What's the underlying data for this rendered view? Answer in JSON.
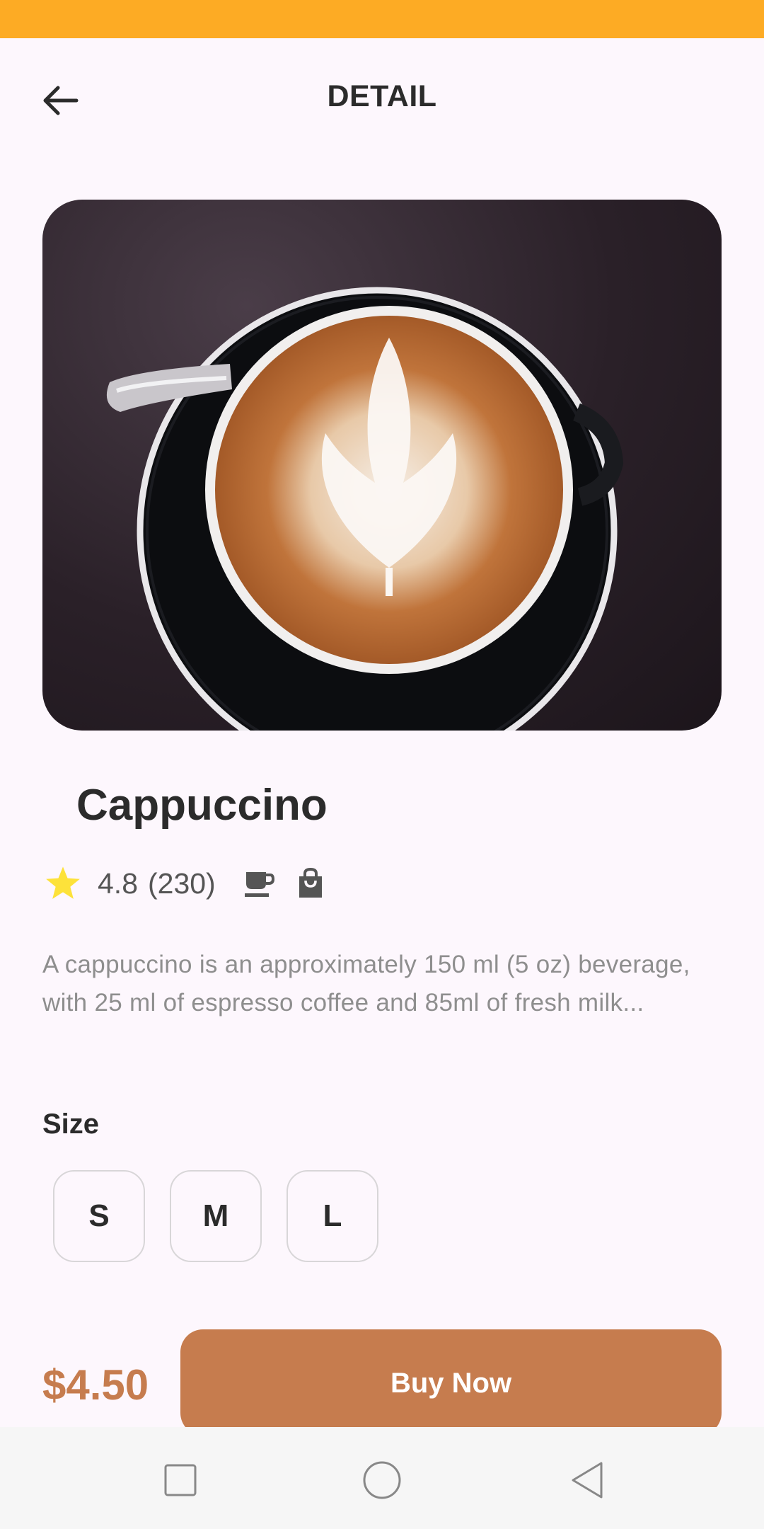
{
  "header": {
    "title": "DETAIL"
  },
  "product": {
    "name": "Cappuccino",
    "rating": "4.8",
    "review_count": "(230)",
    "description": "A cappuccino is an approximately 150 ml (5 oz) beverage, with 25 ml of espresso coffee and 85ml of fresh milk...",
    "price": "$4.50",
    "image": "cappuccino-latte-art-photo"
  },
  "size_section": {
    "label": "Size",
    "options": [
      "S",
      "M",
      "L"
    ]
  },
  "cta": {
    "buy_label": "Buy Now"
  },
  "icons": [
    "back-arrow-icon",
    "star-icon",
    "coffee-cup-icon",
    "shopping-bag-icon",
    "recent-apps-icon",
    "home-icon",
    "back-triangle-icon"
  ],
  "colors": {
    "status_bar": "#fdab24",
    "accent": "#c67c4e",
    "star": "#fde23a",
    "background": "#fdf7fd"
  }
}
